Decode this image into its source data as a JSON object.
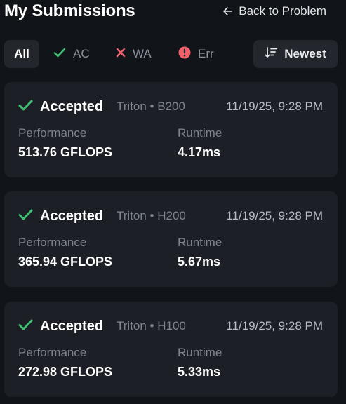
{
  "header": {
    "title": "My Submissions",
    "back_label": "Back to Problem"
  },
  "filters": {
    "all": "All",
    "ac": "AC",
    "wa": "WA",
    "err": "Err",
    "sort": "Newest"
  },
  "colors": {
    "accepted": "#3fbf72",
    "wrong_answer": "#f0606a",
    "error": "#f0606a",
    "background": "#111418",
    "card": "#1c2026"
  },
  "icons": {
    "back": "arrow-left-icon",
    "ac": "check-icon",
    "wa": "x-icon",
    "err": "alert-circle-icon",
    "sort": "sort-descending-icon"
  },
  "submissions": [
    {
      "status": "Accepted",
      "meta": "Triton • B200",
      "time": "11/19/25, 9:28 PM",
      "performance_label": "Performance",
      "performance": "513.76 GFLOPS",
      "runtime_label": "Runtime",
      "runtime": "4.17ms"
    },
    {
      "status": "Accepted",
      "meta": "Triton • H200",
      "time": "11/19/25, 9:28 PM",
      "performance_label": "Performance",
      "performance": "365.94 GFLOPS",
      "runtime_label": "Runtime",
      "runtime": "5.67ms"
    },
    {
      "status": "Accepted",
      "meta": "Triton • H100",
      "time": "11/19/25, 9:28 PM",
      "performance_label": "Performance",
      "performance": "272.98 GFLOPS",
      "runtime_label": "Runtime",
      "runtime": "5.33ms"
    }
  ]
}
